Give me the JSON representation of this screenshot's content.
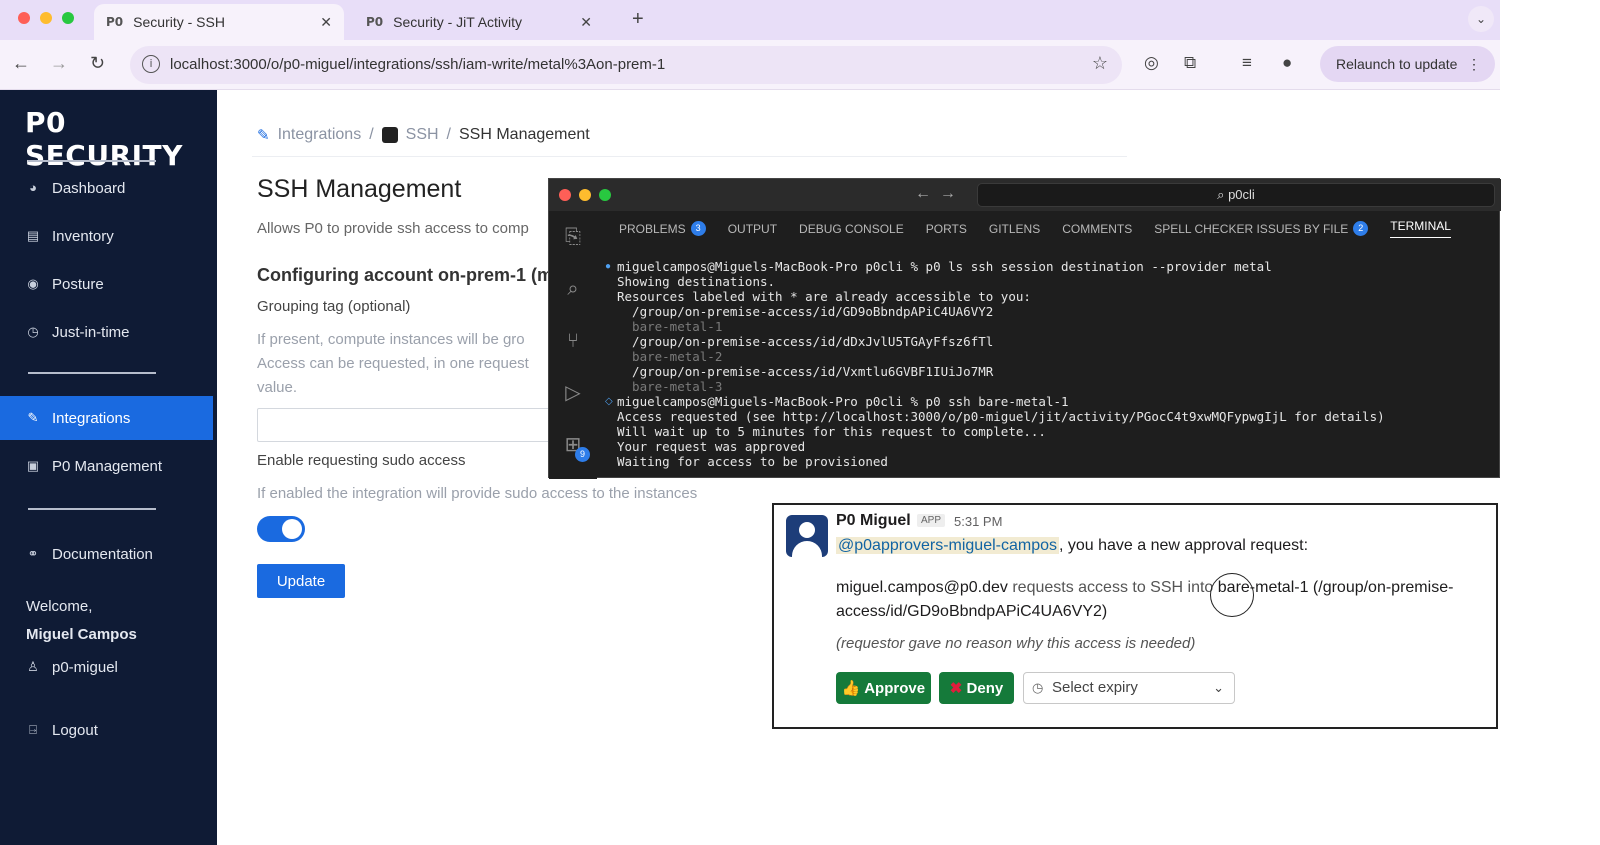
{
  "browser": {
    "tabs": [
      {
        "favicon": "P0",
        "title": "Security - SSH",
        "active": true
      },
      {
        "favicon": "P0",
        "title": "Security - JiT Activity",
        "active": false
      }
    ],
    "url": "localhost:3000/o/p0-miguel/integrations/ssh/iam-write/metal%3Aon-prem-1",
    "relaunch_label": "Relaunch to update"
  },
  "sidebar": {
    "logo": "P0 SECURITY",
    "items_top": [
      {
        "label": "Dashboard",
        "icon": "dashboard-icon"
      },
      {
        "label": "Inventory",
        "icon": "inventory-icon"
      },
      {
        "label": "Posture",
        "icon": "eye-icon"
      },
      {
        "label": "Just-in-time",
        "icon": "clock-icon"
      }
    ],
    "items_mid": [
      {
        "label": "Integrations",
        "icon": "plug-icon",
        "active": true
      },
      {
        "label": "P0 Management",
        "icon": "lock-icon"
      }
    ],
    "documentation": "Documentation",
    "welcome": "Welcome,",
    "user_name": "Miguel Campos",
    "org": "p0-miguel",
    "logout": "Logout"
  },
  "main": {
    "breadcrumb": {
      "integrations": "Integrations",
      "ssh": "SSH",
      "current": "SSH Management"
    },
    "title": "SSH Management",
    "description": "Allows P0 to provide ssh access to comp",
    "config_title": "Configuring account on-prem-1 (m",
    "grouping_label": "Grouping tag (optional)",
    "grouping_help_1": "If present, compute instances will be gro",
    "grouping_help_2": "Access can be requested, in one request",
    "grouping_help_3": "value.",
    "sudo_label": "Enable requesting sudo access",
    "sudo_help": "If enabled the integration will provide sudo access to the instances",
    "sudo_enabled": true,
    "update_label": "Update"
  },
  "vscode": {
    "search": "p0cli",
    "tabs": [
      {
        "label": "PROBLEMS",
        "count": "3"
      },
      {
        "label": "OUTPUT"
      },
      {
        "label": "DEBUG CONSOLE"
      },
      {
        "label": "PORTS"
      },
      {
        "label": "GITLENS"
      },
      {
        "label": "COMMENTS"
      },
      {
        "label": "SPELL CHECKER ISSUES BY FILE",
        "count": "2"
      },
      {
        "label": "TERMINAL",
        "active": true
      }
    ],
    "extensions_badge": "9",
    "terminal_lines": [
      {
        "text": "miguelcampos@Miguels-MacBook-Pro p0cli % p0 ls ssh session destination --provider metal",
        "dim": false
      },
      {
        "text": "Showing destinations.",
        "dim": false
      },
      {
        "text": "Resources labeled with * are already accessible to you:",
        "dim": false
      },
      {
        "text": "  /group/on-premise-access/id/GD9oBbndpAPiC4UA6VY2",
        "dim": false
      },
      {
        "text": "  bare-metal-1",
        "dim": true
      },
      {
        "text": "  /group/on-premise-access/id/dDxJvlU5TGAyFfsz6fTl",
        "dim": false
      },
      {
        "text": "  bare-metal-2",
        "dim": true
      },
      {
        "text": "  /group/on-premise-access/id/Vxmtlu6GVBF1IUiJo7MR",
        "dim": false
      },
      {
        "text": "  bare-metal-3",
        "dim": true
      },
      {
        "text": "miguelcampos@Miguels-MacBook-Pro p0cli % p0 ssh bare-metal-1",
        "dim": false
      },
      {
        "text": "Access requested (see http://localhost:3000/o/p0-miguel/jit/activity/PGocC4t9xwMQFypwgIjL for details)",
        "dim": false
      },
      {
        "text": "Will wait up to 5 minutes for this request to complete...",
        "dim": false
      },
      {
        "text": "Your request was approved",
        "dim": false
      },
      {
        "text": "Waiting for access to be provisioned",
        "dim": false
      }
    ]
  },
  "slack": {
    "sender": "P0 Miguel",
    "app_tag": "APP",
    "time": "5:31 PM",
    "mention": "@p0approvers-miguel-campos",
    "intro_rest": ", you have a new approval request:",
    "requester": "miguel.campos@p0.dev",
    "request_text": " requests access to SSH into ",
    "resource": "bare-metal-1 (/group/on-premise-access/id/GD9oBbndpAPiC4UA6VY2)",
    "reason": "(requestor gave no reason why this access is needed)",
    "approve_label": "Approve",
    "deny_label": "Deny",
    "expiry_placeholder": "Select expiry"
  },
  "colors": {
    "sidebar_bg": "#0f1b35",
    "accent": "#1a6ae0",
    "slack_green": "#157a3a",
    "terminal_bg": "#1e1e1e"
  }
}
